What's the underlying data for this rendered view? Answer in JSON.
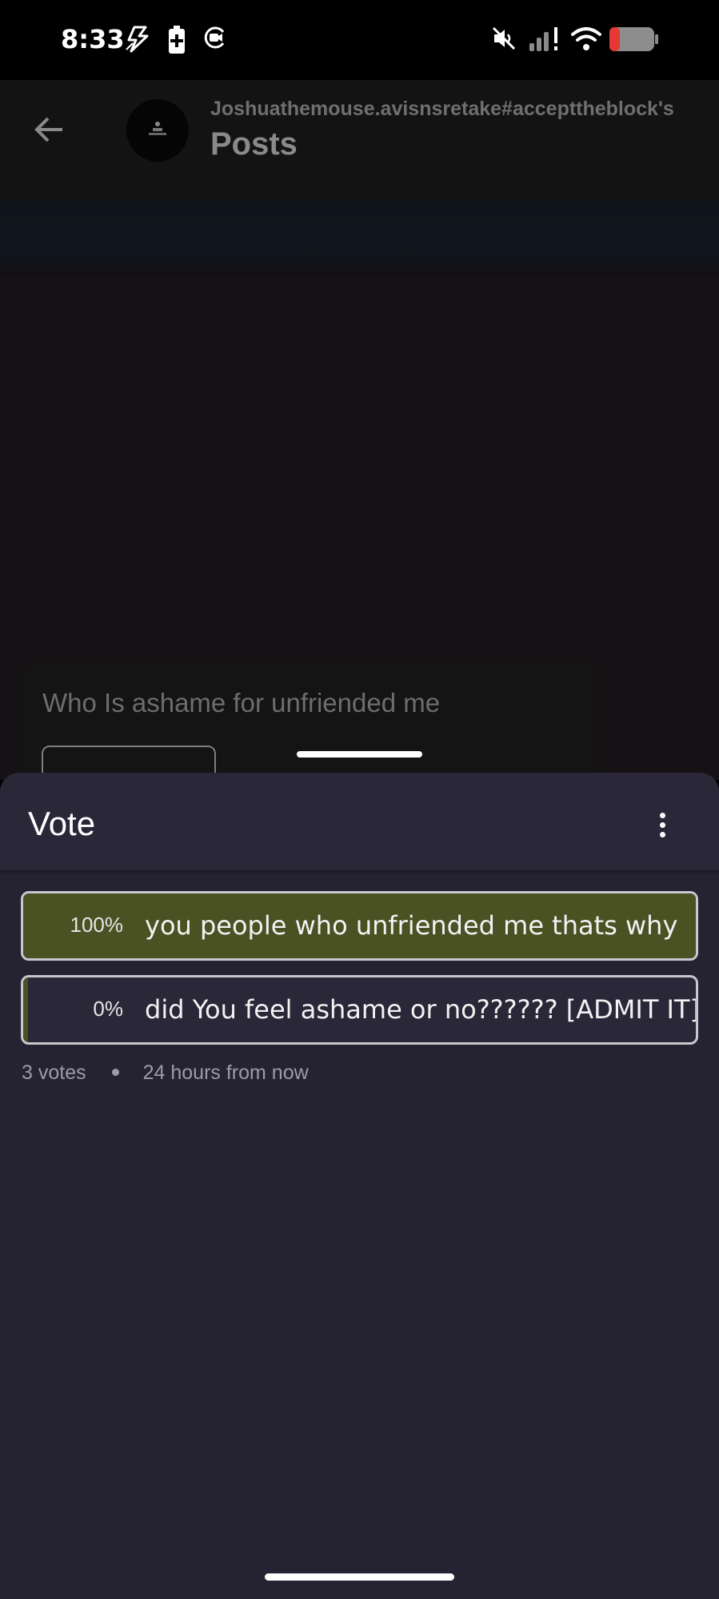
{
  "status_bar": {
    "time": "8:33",
    "icons": [
      "flash-icon",
      "battery-saver-icon",
      "screen-record-icon",
      "mute-icon",
      "signal-icon",
      "wifi-icon",
      "battery-icon"
    ],
    "battery_color": "#e53935"
  },
  "header": {
    "username": "Joshuathemouse.avisnsretake#accepttheblock's",
    "title": "Posts"
  },
  "post": {
    "question": "Who Is ashame for unfriended me"
  },
  "sheet": {
    "title": "Vote",
    "options": [
      {
        "percent_label": "100%",
        "text": "you people who unfriended me thats why",
        "share": 1.0
      },
      {
        "percent_label": "0%",
        "text": "did You feel ashame or no?????? [ADMIT IT]",
        "share": 0.0
      }
    ],
    "votes": "3 votes",
    "time_left": "24 hours from now",
    "fill_color": "#4a5224"
  }
}
